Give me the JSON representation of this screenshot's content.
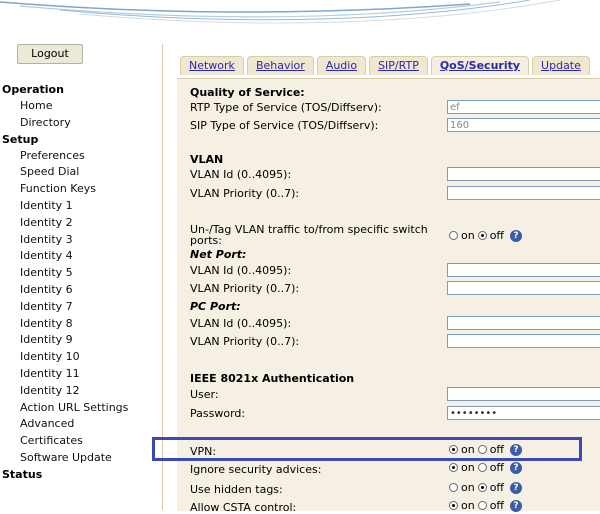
{
  "sidebar": {
    "logout_label": "Logout",
    "sections": [
      {
        "title": "Operation",
        "items": [
          "Home",
          "Directory"
        ]
      },
      {
        "title": "Setup",
        "items": [
          "Preferences",
          "Speed Dial",
          "Function Keys",
          "Identity 1",
          "Identity 2",
          "Identity 3",
          "Identity 4",
          "Identity 5",
          "Identity 6",
          "Identity 7",
          "Identity 8",
          "Identity 9",
          "Identity 10",
          "Identity 11",
          "Identity 12",
          "Action URL Settings",
          "Advanced",
          "Certificates",
          "Software Update"
        ]
      },
      {
        "title": "Status",
        "items": []
      }
    ]
  },
  "tabs": {
    "items": [
      "Network",
      "Behavior",
      "Audio",
      "SIP/RTP",
      "QoS/Security",
      "Update"
    ],
    "active": "QoS/Security"
  },
  "form": {
    "qos": {
      "title": "Quality of Service:",
      "rtp_label": "RTP Type of Service (TOS/Diffserv):",
      "rtp_value": "ef",
      "sip_label": "SIP Type of Service (TOS/Diffserv):",
      "sip_value": "160"
    },
    "vlan": {
      "title": "VLAN",
      "id_label": "VLAN Id (0..4095):",
      "priority_label": "VLAN Priority (0..7):",
      "untag_label": "Un-/Tag VLAN traffic to/from specific switch ports:",
      "untag_value": "off",
      "net_port_label": "Net Port:",
      "net_id_label": "VLAN Id (0..4095):",
      "net_priority_label": "VLAN Priority (0..7):",
      "pc_port_label": "PC Port:",
      "pc_id_label": "VLAN Id (0..4095):",
      "pc_priority_label": "VLAN Priority (0..7):"
    },
    "ieee": {
      "title": "IEEE 8021x Authentication",
      "user_label": "User:",
      "password_label": "Password:",
      "password_value": "••••••••"
    },
    "vpn": {
      "label": "VPN:",
      "value": "on"
    },
    "ignore_security": {
      "label": "Ignore security advices:",
      "value": "on"
    },
    "hidden_tags": {
      "label": "Use hidden tags:",
      "value": "off"
    },
    "csta": {
      "label": "Allow CSTA control:",
      "value": "on"
    },
    "radio_on": "on",
    "radio_off": "off",
    "help_glyph": "?"
  },
  "colors": {
    "highlight": "#3a48b8",
    "panel_bg": "#f5f0e3",
    "tab_link": "#2a2aa8",
    "help_icon": "#3b5ca8"
  }
}
